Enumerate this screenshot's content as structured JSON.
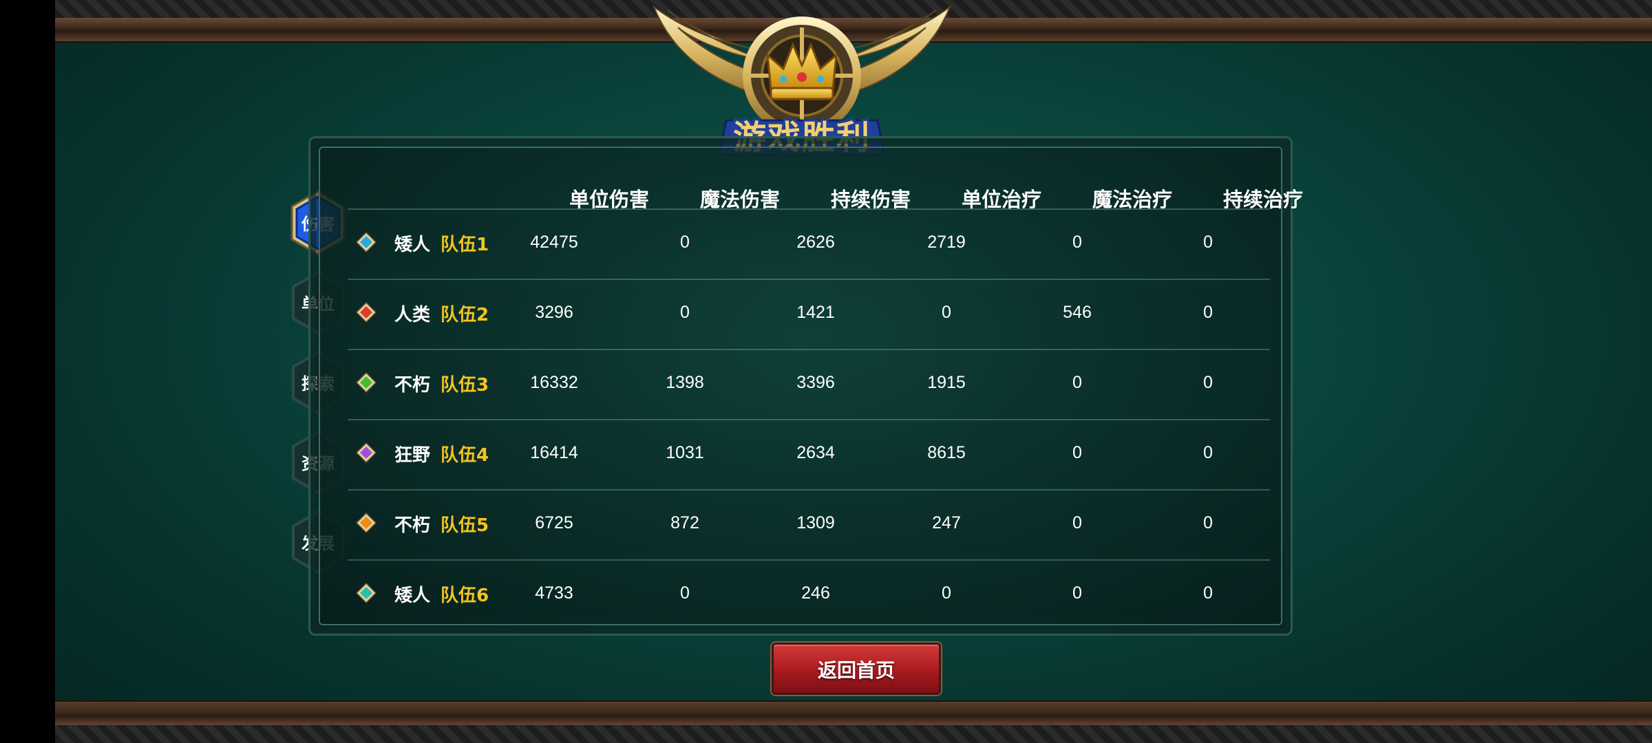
{
  "title": "游戏胜利",
  "tabs": [
    {
      "label": "伤害",
      "active": true
    },
    {
      "label": "单位",
      "active": false
    },
    {
      "label": "探索",
      "active": false
    },
    {
      "label": "资源",
      "active": false
    },
    {
      "label": "发展",
      "active": false
    }
  ],
  "columns": [
    "单位伤害",
    "魔法伤害",
    "持续伤害",
    "单位治疗",
    "魔法治疗",
    "持续治疗"
  ],
  "rows": [
    {
      "race": "矮人",
      "team": "队伍1",
      "gem_color": "#2aa9e0",
      "values": [
        "42475",
        "0",
        "2626",
        "2719",
        "0",
        "0"
      ]
    },
    {
      "race": "人类",
      "team": "队伍2",
      "gem_color": "#e03a2a",
      "values": [
        "3296",
        "0",
        "1421",
        "0",
        "546",
        "0"
      ]
    },
    {
      "race": "不朽",
      "team": "队伍3",
      "gem_color": "#3fbf2f",
      "values": [
        "16332",
        "1398",
        "3396",
        "1915",
        "0",
        "0"
      ]
    },
    {
      "race": "狂野",
      "team": "队伍4",
      "gem_color": "#a24fd8",
      "values": [
        "16414",
        "1031",
        "2634",
        "8615",
        "0",
        "0"
      ]
    },
    {
      "race": "不朽",
      "team": "队伍5",
      "gem_color": "#ef8a17",
      "values": [
        "6725",
        "872",
        "1309",
        "247",
        "0",
        "0"
      ]
    },
    {
      "race": "矮人",
      "team": "队伍6",
      "gem_color": "#27c0a8",
      "values": [
        "4733",
        "0",
        "246",
        "0",
        "0",
        "0"
      ]
    }
  ],
  "home_button": "返回首页",
  "colors": {
    "team_label": "#f5c51c",
    "active_tab": "#1e5ce6",
    "button_red": "#b8222a",
    "background": "#0a4840"
  }
}
